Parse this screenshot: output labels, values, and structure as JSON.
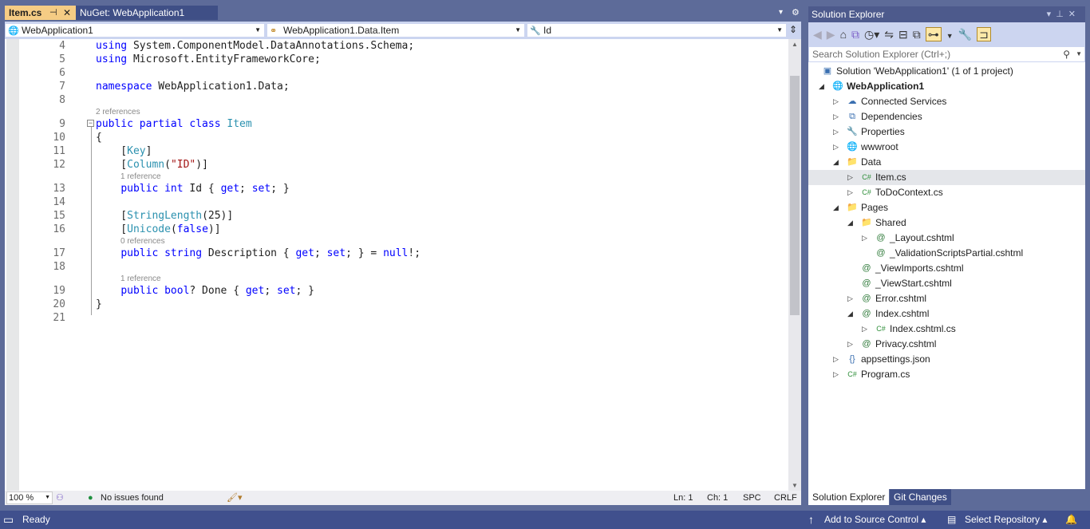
{
  "tabs": [
    {
      "label": "Item.cs",
      "active": true
    },
    {
      "label": "NuGet: WebApplication1",
      "active": false
    }
  ],
  "navbar": {
    "project": "WebApplication1",
    "type": "WebApplication1.Data.Item",
    "member": "Id"
  },
  "code": [
    {
      "n": "4",
      "t": [
        [
          "using",
          "kw"
        ],
        [
          " System.ComponentModel.DataAnnotations.Schema;",
          "pl"
        ]
      ]
    },
    {
      "n": "5",
      "t": [
        [
          "using",
          "kw"
        ],
        [
          " Microsoft.EntityFrameworkCore;",
          "pl"
        ]
      ]
    },
    {
      "n": "6",
      "t": []
    },
    {
      "n": "7",
      "t": [
        [
          "namespace",
          "kw"
        ],
        [
          " WebApplication1.Data;",
          "pl"
        ]
      ]
    },
    {
      "n": "8",
      "t": []
    },
    {
      "lens": "2 references",
      "indent": 0
    },
    {
      "n": "9",
      "t": [
        [
          "public partial class",
          "kw"
        ],
        [
          " ",
          "pl"
        ],
        [
          "Item",
          "ty"
        ]
      ]
    },
    {
      "n": "10",
      "t": [
        [
          "{",
          "pl"
        ]
      ]
    },
    {
      "n": "11",
      "t": [
        [
          "    [",
          "pl"
        ],
        [
          "Key",
          "ty"
        ],
        [
          "]",
          "pl"
        ]
      ]
    },
    {
      "n": "12",
      "t": [
        [
          "    [",
          "pl"
        ],
        [
          "Column",
          "ty"
        ],
        [
          "(",
          "pl"
        ],
        [
          "\"ID\"",
          "st"
        ],
        [
          ")]",
          "pl"
        ]
      ]
    },
    {
      "lens": "1 reference",
      "indent": 1
    },
    {
      "n": "13",
      "t": [
        [
          "    ",
          "pl"
        ],
        [
          "public int",
          "kw"
        ],
        [
          " Id { ",
          "pl"
        ],
        [
          "get",
          "kw"
        ],
        [
          "; ",
          "pl"
        ],
        [
          "set",
          "kw"
        ],
        [
          "; }",
          "pl"
        ]
      ]
    },
    {
      "n": "14",
      "t": []
    },
    {
      "n": "15",
      "t": [
        [
          "    [",
          "pl"
        ],
        [
          "StringLength",
          "ty"
        ],
        [
          "(25)]",
          "pl"
        ]
      ]
    },
    {
      "n": "16",
      "t": [
        [
          "    [",
          "pl"
        ],
        [
          "Unicode",
          "ty"
        ],
        [
          "(",
          "pl"
        ],
        [
          "false",
          "kw"
        ],
        [
          ")]",
          "pl"
        ]
      ]
    },
    {
      "lens": "0 references",
      "indent": 1
    },
    {
      "n": "17",
      "t": [
        [
          "    ",
          "pl"
        ],
        [
          "public string",
          "kw"
        ],
        [
          " Description { ",
          "pl"
        ],
        [
          "get",
          "kw"
        ],
        [
          "; ",
          "pl"
        ],
        [
          "set",
          "kw"
        ],
        [
          "; } = ",
          "pl"
        ],
        [
          "null",
          "kw"
        ],
        [
          "!;",
          "pl"
        ]
      ]
    },
    {
      "n": "18",
      "t": []
    },
    {
      "lens": "1 reference",
      "indent": 1
    },
    {
      "n": "19",
      "t": [
        [
          "    ",
          "pl"
        ],
        [
          "public bool",
          "kw"
        ],
        [
          "? Done { ",
          "pl"
        ],
        [
          "get",
          "kw"
        ],
        [
          "; ",
          "pl"
        ],
        [
          "set",
          "kw"
        ],
        [
          "; }",
          "pl"
        ]
      ]
    },
    {
      "n": "20",
      "t": [
        [
          "}",
          "pl"
        ]
      ]
    },
    {
      "n": "21",
      "t": []
    }
  ],
  "editor_status": {
    "zoom": "100 %",
    "issues": "No issues found",
    "ln": "Ln: 1",
    "ch": "Ch: 1",
    "spc": "SPC",
    "crlf": "CRLF"
  },
  "solution_explorer": {
    "title": "Solution Explorer",
    "search_placeholder": "Search Solution Explorer (Ctrl+;)",
    "items": [
      {
        "label": "Solution 'WebApplication1' (1 of 1 project)",
        "level": 0,
        "exp": "",
        "icon": "▣"
      },
      {
        "label": "WebApplication1",
        "level": 0,
        "exp": "◢",
        "icon": "🌐",
        "bold": true
      },
      {
        "label": "Connected Services",
        "level": 1,
        "exp": "▷",
        "icon": "☁"
      },
      {
        "label": "Dependencies",
        "level": 1,
        "exp": "▷",
        "icon": "⧉"
      },
      {
        "label": "Properties",
        "level": 1,
        "exp": "▷",
        "icon": "🔧"
      },
      {
        "label": "wwwroot",
        "level": 1,
        "exp": "▷",
        "icon": "🌐"
      },
      {
        "label": "Data",
        "level": 1,
        "exp": "◢",
        "icon": "📁"
      },
      {
        "label": "Item.cs",
        "level": 2,
        "exp": "▷",
        "icon": "C#",
        "selected": true
      },
      {
        "label": "ToDoContext.cs",
        "level": 2,
        "exp": "▷",
        "icon": "C#"
      },
      {
        "label": "Pages",
        "level": 1,
        "exp": "◢",
        "icon": "📁"
      },
      {
        "label": "Shared",
        "level": 2,
        "exp": "◢",
        "icon": "📁"
      },
      {
        "label": "_Layout.cshtml",
        "level": 3,
        "exp": "▷",
        "icon": "@"
      },
      {
        "label": "_ValidationScriptsPartial.cshtml",
        "level": 3,
        "exp": "",
        "icon": "@"
      },
      {
        "label": "_ViewImports.cshtml",
        "level": 2,
        "exp": "",
        "icon": "@"
      },
      {
        "label": "_ViewStart.cshtml",
        "level": 2,
        "exp": "",
        "icon": "@"
      },
      {
        "label": "Error.cshtml",
        "level": 2,
        "exp": "▷",
        "icon": "@"
      },
      {
        "label": "Index.cshtml",
        "level": 2,
        "exp": "◢",
        "icon": "@"
      },
      {
        "label": "Index.cshtml.cs",
        "level": 3,
        "exp": "▷",
        "icon": "C#"
      },
      {
        "label": "Privacy.cshtml",
        "level": 2,
        "exp": "▷",
        "icon": "@"
      },
      {
        "label": "appsettings.json",
        "level": 1,
        "exp": "▷",
        "icon": "{}"
      },
      {
        "label": "Program.cs",
        "level": 1,
        "exp": "▷",
        "icon": "C#"
      }
    ],
    "bottom_tabs": [
      "Solution Explorer",
      "Git Changes"
    ]
  },
  "statusbar": {
    "ready": "Ready",
    "source_control": "Add to Source Control",
    "repository": "Select Repository"
  }
}
